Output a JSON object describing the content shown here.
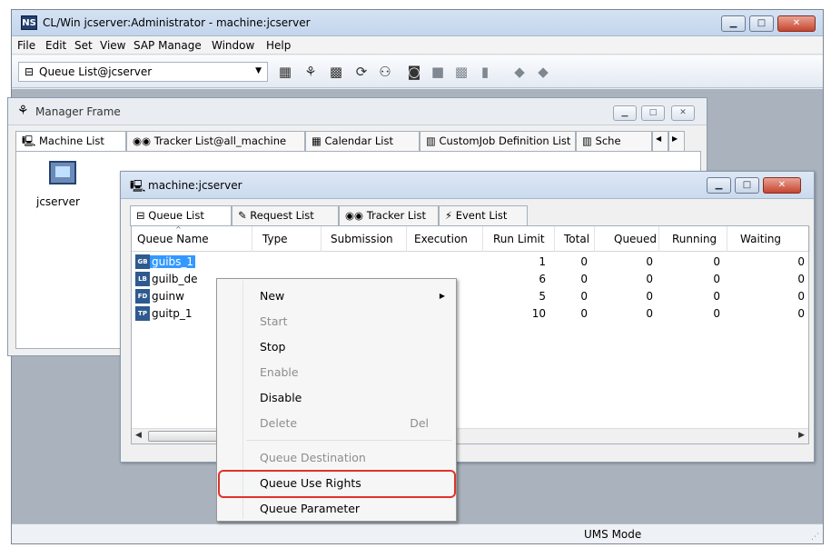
{
  "app": {
    "icon_text": "NS",
    "title": "CL/Win jcserver:Administrator - machine:jcserver"
  },
  "menu": [
    "File",
    "Edit",
    "Set",
    "View",
    "SAP Manage",
    "Window",
    "Help"
  ],
  "toolbar": {
    "combo_value": "Queue List@jcserver"
  },
  "manager_frame": {
    "title": "Manager Frame",
    "tabs": [
      "Machine List",
      "Tracker List@all_machine",
      "Calendar List",
      "CustomJob Definition List",
      "Sche"
    ],
    "server_label": "jcserver"
  },
  "machine_window": {
    "title": "machine:jcserver",
    "tabs": [
      "Queue List",
      "Request List",
      "Tracker List",
      "Event List"
    ],
    "columns": [
      "Queue Name",
      "Type",
      "Submission",
      "Execution",
      "Run Limit",
      "Total",
      "Queued",
      "Running",
      "Waiting"
    ],
    "rows": [
      {
        "icon": "GB",
        "name": "guibs_1",
        "run_limit": "1",
        "total": "0",
        "queued": "0",
        "running": "0",
        "waiting": "0"
      },
      {
        "icon": "LB",
        "name": "guilb_de",
        "run_limit": "6",
        "total": "0",
        "queued": "0",
        "running": "0",
        "waiting": "0"
      },
      {
        "icon": "FD",
        "name": "guinw",
        "run_limit": "5",
        "total": "0",
        "queued": "0",
        "running": "0",
        "waiting": "0"
      },
      {
        "icon": "TP",
        "name": "guitp_1",
        "run_limit": "10",
        "total": "0",
        "queued": "0",
        "running": "0",
        "waiting": "0"
      }
    ]
  },
  "context_menu": {
    "items": [
      {
        "label": "New",
        "disabled": false
      },
      {
        "label": "Start",
        "disabled": true
      },
      {
        "label": "Stop",
        "disabled": false
      },
      {
        "label": "Enable",
        "disabled": true
      },
      {
        "label": "Disable",
        "disabled": false
      },
      {
        "label": "Delete",
        "disabled": true,
        "shortcut": "Del"
      },
      {
        "label": "Queue Destination",
        "disabled": true
      },
      {
        "label": "Queue Use Rights",
        "disabled": false
      },
      {
        "label": "Queue Parameter",
        "disabled": false
      }
    ]
  },
  "status": {
    "mode": "UMS Mode"
  },
  "colors": {
    "selection": "#3399ff",
    "highlight_box": "#e0322b"
  }
}
